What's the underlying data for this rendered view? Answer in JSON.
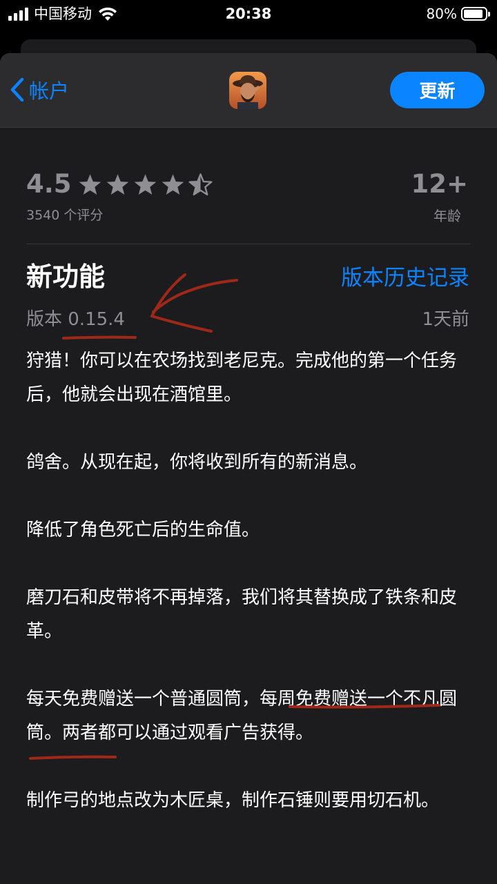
{
  "status_bar": {
    "carrier": "中国移动",
    "time": "20:38",
    "battery": "80%",
    "battery_level": 0.8
  },
  "nav": {
    "back_label": "帐户",
    "app_icon": "cowboy-game-icon",
    "update_label": "更新"
  },
  "ratings": {
    "score": "4.5",
    "stars": 4.5,
    "count": "3540 个评分",
    "age": "12+",
    "age_label": "年龄"
  },
  "whats_new": {
    "title": "新功能",
    "history_link": "版本历史记录",
    "version": "版本 0.15.4",
    "updated": "1天前",
    "notes": [
      "狩猎！你可以在农场找到老尼克。完成他的第一个任务后，他就会出现在酒馆里。",
      "鸽舍。从现在起，你将收到所有的新消息。",
      "降低了角色死亡后的生命值。",
      "磨刀石和皮带将不再掉落，我们将其替换成了铁条和皮革。",
      "每天免费赠送一个普通圆筒，每周免费赠送一个不凡圆筒。两者都可以通过观看广告获得。",
      "制作弓的地点改为木匠桌，制作石锤则要用切石机。"
    ]
  },
  "colors": {
    "accent": "#0a84ff",
    "annotation": "#a02818",
    "secondary_text": "#8e8e93",
    "sheet_bg": "#1c1c1e"
  }
}
